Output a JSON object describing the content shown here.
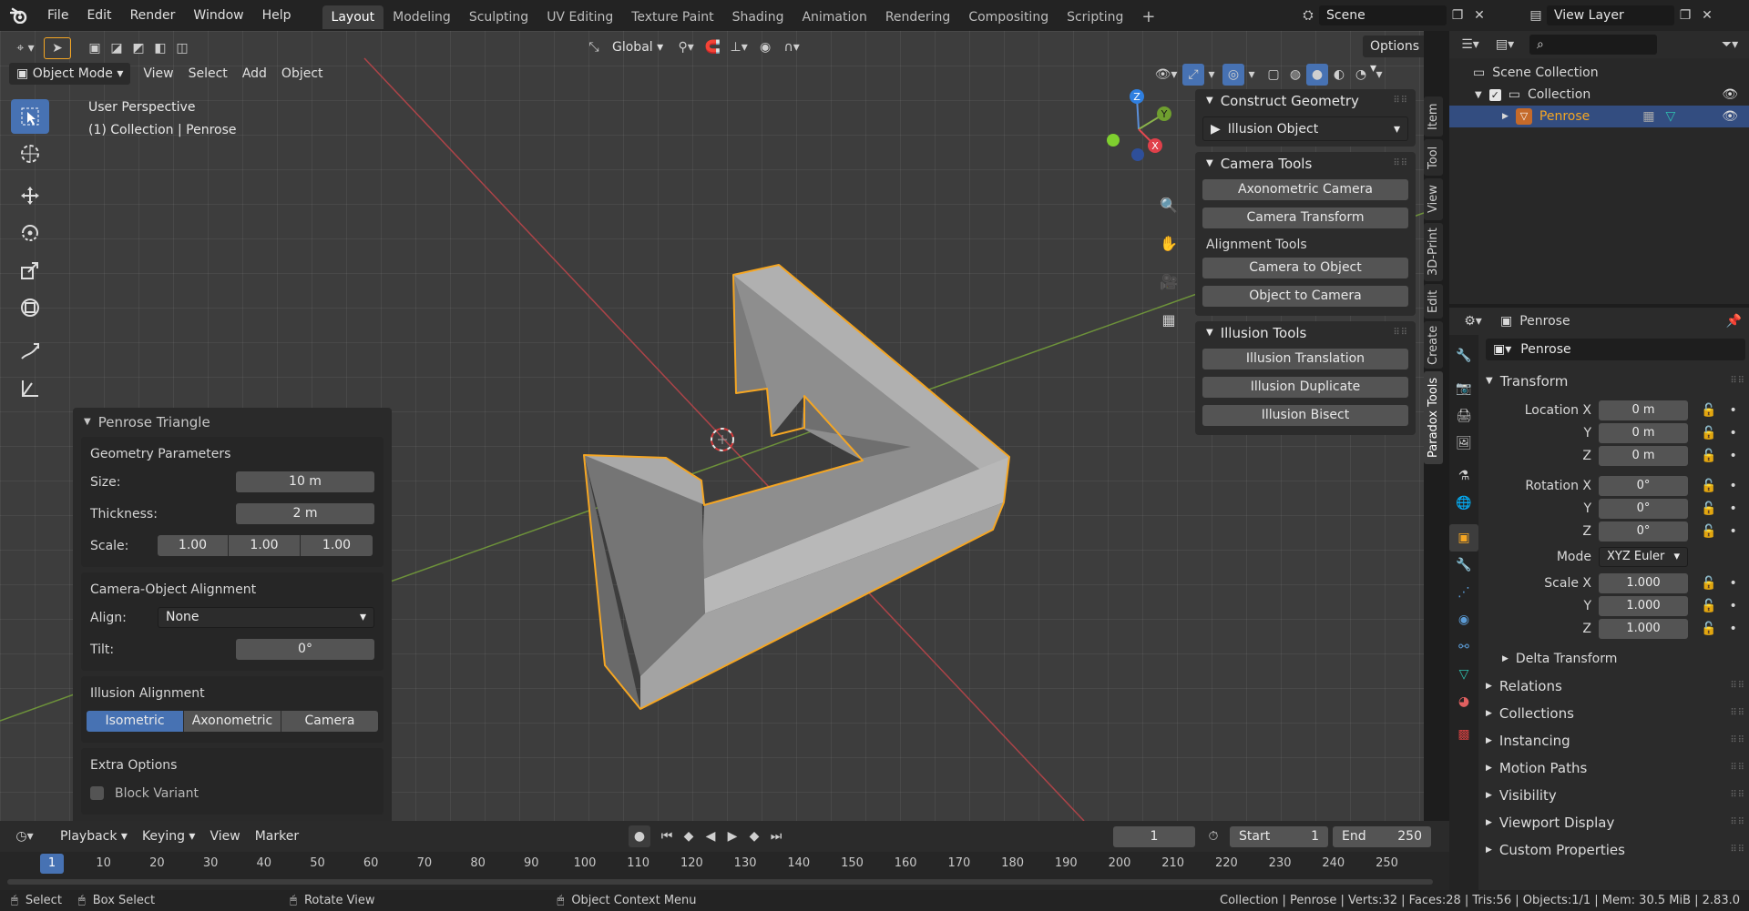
{
  "menu": [
    "File",
    "Edit",
    "Render",
    "Window",
    "Help"
  ],
  "workspaces": [
    "Layout",
    "Modeling",
    "Sculpting",
    "UV Editing",
    "Texture Paint",
    "Shading",
    "Animation",
    "Rendering",
    "Compositing",
    "Scripting"
  ],
  "add_tab": "+",
  "scene": "Scene",
  "view_layer": "View Layer",
  "header": {
    "transform_orientation": "Global",
    "options": "Options",
    "mode": "Object Mode",
    "menus": [
      "View",
      "Select",
      "Add",
      "Object"
    ]
  },
  "viewport": {
    "overlay_line1": "User Perspective",
    "overlay_line2": "(1) Collection | Penrose",
    "gizmo": {
      "z": "Z",
      "y": "Y",
      "x": "X"
    }
  },
  "penrose_panel": {
    "title": "Penrose Triangle",
    "geometry_title": "Geometry Parameters",
    "size_label": "Size:",
    "size_value": "10 m",
    "thickness_label": "Thickness:",
    "thickness_value": "2 m",
    "scale_label": "Scale:",
    "scale_values": [
      "1.00",
      "1.00",
      "1.00"
    ],
    "alignment_title": "Camera-Object Alignment",
    "align_label": "Align:",
    "align_value": "None",
    "tilt_label": "Tilt:",
    "tilt_value": "0°",
    "illusion_title": "Illusion Alignment",
    "illusion_options": [
      "Isometric",
      "Axonometric",
      "Camera"
    ],
    "extra_title": "Extra Options",
    "block_variant": "Block Variant"
  },
  "sidebar": {
    "construct_title": "Construct Geometry",
    "illusion_object": "Illusion Object",
    "camera_tools_title": "Camera Tools",
    "axonometric_camera": "Axonometric Camera",
    "camera_transform": "Camera Transform",
    "alignment_tools": "Alignment Tools",
    "camera_to_object": "Camera to Object",
    "object_to_camera": "Object to Camera",
    "illusion_tools_title": "Illusion Tools",
    "illusion_translation": "Illusion Translation",
    "illusion_duplicate": "Illusion Duplicate",
    "illusion_bisect": "Illusion Bisect",
    "tabs": [
      "Item",
      "Tool",
      "View",
      "3D-Print",
      "Edit",
      "Create",
      "Paradox Tools"
    ]
  },
  "outliner": {
    "scene_collection": "Scene Collection",
    "collection": "Collection",
    "object": "Penrose"
  },
  "properties": {
    "object_name": "Penrose",
    "object_field": "Penrose",
    "transform_title": "Transform",
    "location_x_label": "Location X",
    "location_x": "0 m",
    "location_y_label": "Y",
    "location_y": "0 m",
    "location_z_label": "Z",
    "location_z": "0 m",
    "rotation_x_label": "Rotation X",
    "rotation_x": "0°",
    "rotation_y_label": "Y",
    "rotation_y": "0°",
    "rotation_z_label": "Z",
    "rotation_z": "0°",
    "mode_label": "Mode",
    "mode_value": "XYZ Euler",
    "scale_x_label": "Scale X",
    "scale_x": "1.000",
    "scale_y_label": "Y",
    "scale_y": "1.000",
    "scale_z_label": "Z",
    "scale_z": "1.000",
    "delta_transform": "Delta Transform",
    "sections": [
      "Relations",
      "Collections",
      "Instancing",
      "Motion Paths",
      "Visibility",
      "Viewport Display",
      "Custom Properties"
    ]
  },
  "timeline": {
    "menus": [
      "Playback",
      "Keying",
      "View",
      "Marker"
    ],
    "current_frame": "1",
    "start_label": "Start",
    "start": "1",
    "end_label": "End",
    "end": "250",
    "ruler": [
      "1",
      "10",
      "20",
      "30",
      "40",
      "50",
      "60",
      "70",
      "80",
      "90",
      "100",
      "110",
      "120",
      "130",
      "140",
      "150",
      "160",
      "170",
      "180",
      "190",
      "200",
      "210",
      "220",
      "230",
      "240",
      "250"
    ]
  },
  "status": {
    "select": "Select",
    "box_select": "Box Select",
    "rotate_view": "Rotate View",
    "context_menu": "Object Context Menu",
    "stats": "Collection | Penrose | Verts:32 | Faces:28 | Tris:56 | Objects:1/1 | Mem: 30.5 MiB | 2.83.0"
  },
  "colors": {
    "accent": "#4772b3",
    "selection": "#f5a623",
    "object_fill": "#9a9a9a"
  }
}
